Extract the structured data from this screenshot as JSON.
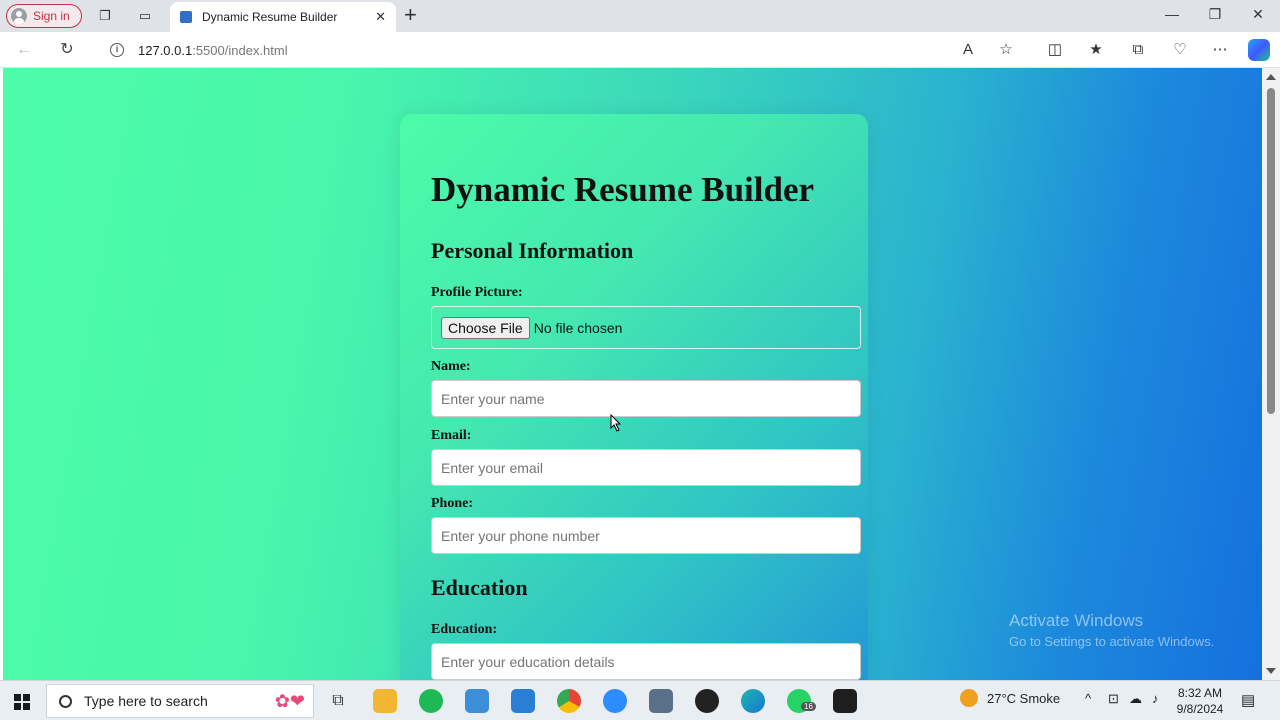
{
  "browser": {
    "signin_label": "Sign in",
    "tab_title": "Dynamic Resume Builder",
    "url_host": "127.0.0.1",
    "url_path": ":5500/index.html"
  },
  "page": {
    "heading": "Dynamic Resume Builder",
    "section_personal": "Personal Information",
    "profile_label": "Profile Picture:",
    "file_button": "Choose File",
    "file_status": "No file chosen",
    "name_label": "Name:",
    "name_placeholder": "Enter your name",
    "email_label": "Email:",
    "email_placeholder": "Enter your email",
    "phone_label": "Phone:",
    "phone_placeholder": "Enter your phone number",
    "section_education": "Education",
    "education_label": "Education:",
    "education_placeholder": "Enter your education details"
  },
  "watermark": {
    "line1": "Activate Windows",
    "line2": "Go to Settings to activate Windows."
  },
  "taskbar": {
    "search_placeholder": "Type here to search",
    "weather": "27°C  Smoke",
    "time": "8:32 AM",
    "date": "9/8/2024",
    "whatsapp_badge": "16"
  }
}
